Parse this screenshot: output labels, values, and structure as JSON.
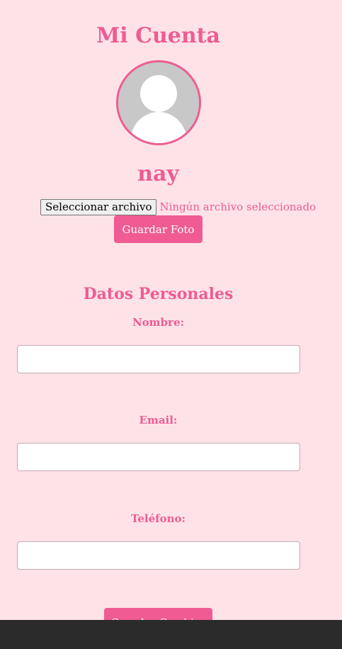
{
  "header": {
    "title": "Mi Cuenta"
  },
  "profile": {
    "avatar_icon": "default-user-avatar",
    "username": "nay",
    "file_button_label": "Seleccionar archivo",
    "file_status": "Ningún archivo seleccionado",
    "save_photo_label": "Guardar Foto"
  },
  "personal": {
    "section_title": "Datos Personales",
    "nombre": {
      "label": "Nombre:",
      "value": ""
    },
    "email": {
      "label": "Email:",
      "value": ""
    },
    "telefono": {
      "label": "Teléfono:",
      "value": ""
    },
    "save_label": "Guardar Cambios"
  },
  "colors": {
    "accent": "#ef5b92",
    "background": "#fde3e8",
    "bottom_bar": "#2b2b2b"
  }
}
